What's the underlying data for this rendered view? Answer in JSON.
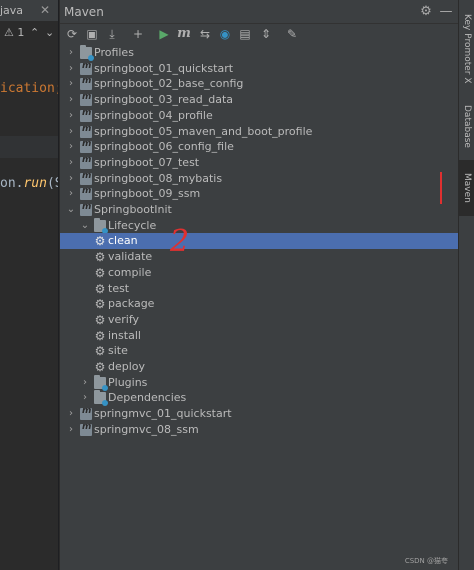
{
  "editor": {
    "tab_label": "java",
    "tab_close": "✕",
    "warning_text": "⚠ 1",
    "chevron_up": "⌃",
    "chevron_down": "⌄",
    "code_line_1": "ication;",
    "code_line_2_prefix": "on.",
    "code_line_2_method": "run",
    "code_line_2_suffix": "(Sp"
  },
  "panel": {
    "title": "Maven",
    "header_icons": [
      "gear-icon",
      "minimize-icon"
    ],
    "toolbar_icons": [
      "reload-icon",
      "add-maven-project-icon",
      "download-icon",
      "add-icon",
      "run-icon",
      "execute-goal-icon",
      "toggle-offline-icon",
      "skip-tests-icon",
      "show-dependencies-icon",
      "collapse-all-icon",
      "settings-wrench-icon"
    ]
  },
  "tree": {
    "items": [
      {
        "label": "Profiles",
        "level": 0,
        "expanded": false,
        "icon": "folder-icon"
      },
      {
        "label": "springboot_01_quickstart",
        "level": 0,
        "expanded": false,
        "icon": "maven-project-icon"
      },
      {
        "label": "springboot_02_base_config",
        "level": 0,
        "expanded": false,
        "icon": "maven-project-icon"
      },
      {
        "label": "springboot_03_read_data",
        "level": 0,
        "expanded": false,
        "icon": "maven-project-icon"
      },
      {
        "label": "springboot_04_profile",
        "level": 0,
        "expanded": false,
        "icon": "maven-project-icon"
      },
      {
        "label": "springboot_05_maven_and_boot_profile",
        "level": 0,
        "expanded": false,
        "icon": "maven-project-icon"
      },
      {
        "label": "springboot_06_config_file",
        "level": 0,
        "expanded": false,
        "icon": "maven-project-icon"
      },
      {
        "label": "springboot_07_test",
        "level": 0,
        "expanded": false,
        "icon": "maven-project-icon"
      },
      {
        "label": "springboot_08_mybatis",
        "level": 0,
        "expanded": false,
        "icon": "maven-project-icon"
      },
      {
        "label": "springboot_09_ssm",
        "level": 0,
        "expanded": false,
        "icon": "maven-project-icon"
      },
      {
        "label": "SpringbootInit",
        "level": 0,
        "expanded": true,
        "icon": "maven-project-icon"
      },
      {
        "label": "Lifecycle",
        "level": 1,
        "expanded": true,
        "icon": "folder-icon"
      },
      {
        "label": "clean",
        "level": 2,
        "icon": "gear-icon",
        "selected": true
      },
      {
        "label": "validate",
        "level": 2,
        "icon": "gear-icon"
      },
      {
        "label": "compile",
        "level": 2,
        "icon": "gear-icon"
      },
      {
        "label": "test",
        "level": 2,
        "icon": "gear-icon"
      },
      {
        "label": "package",
        "level": 2,
        "icon": "gear-icon"
      },
      {
        "label": "verify",
        "level": 2,
        "icon": "gear-icon"
      },
      {
        "label": "install",
        "level": 2,
        "icon": "gear-icon"
      },
      {
        "label": "site",
        "level": 2,
        "icon": "gear-icon"
      },
      {
        "label": "deploy",
        "level": 2,
        "icon": "gear-icon"
      },
      {
        "label": "Plugins",
        "level": 1,
        "expanded": false,
        "icon": "folder-icon"
      },
      {
        "label": "Dependencies",
        "level": 1,
        "expanded": false,
        "icon": "folder-icon"
      },
      {
        "label": "springmvc_01_quickstart",
        "level": 0,
        "expanded": false,
        "icon": "maven-project-icon"
      },
      {
        "label": "springmvc_08_ssm",
        "level": 0,
        "expanded": false,
        "icon": "maven-project-icon"
      }
    ]
  },
  "annotations": {
    "number_2": "2"
  },
  "watermark": "CSDN @猫夸",
  "right_strip": {
    "tabs": [
      {
        "label": "Key Promoter X",
        "icon": "key-promoter-icon",
        "active": false
      },
      {
        "label": "Database",
        "icon": "database-icon",
        "active": false
      },
      {
        "label": "Maven",
        "icon": "maven-icon",
        "active": true
      }
    ]
  },
  "colors": {
    "selection": "#4b6eaf",
    "panel_bg": "#3c3f41",
    "annotation": "#e03030"
  }
}
